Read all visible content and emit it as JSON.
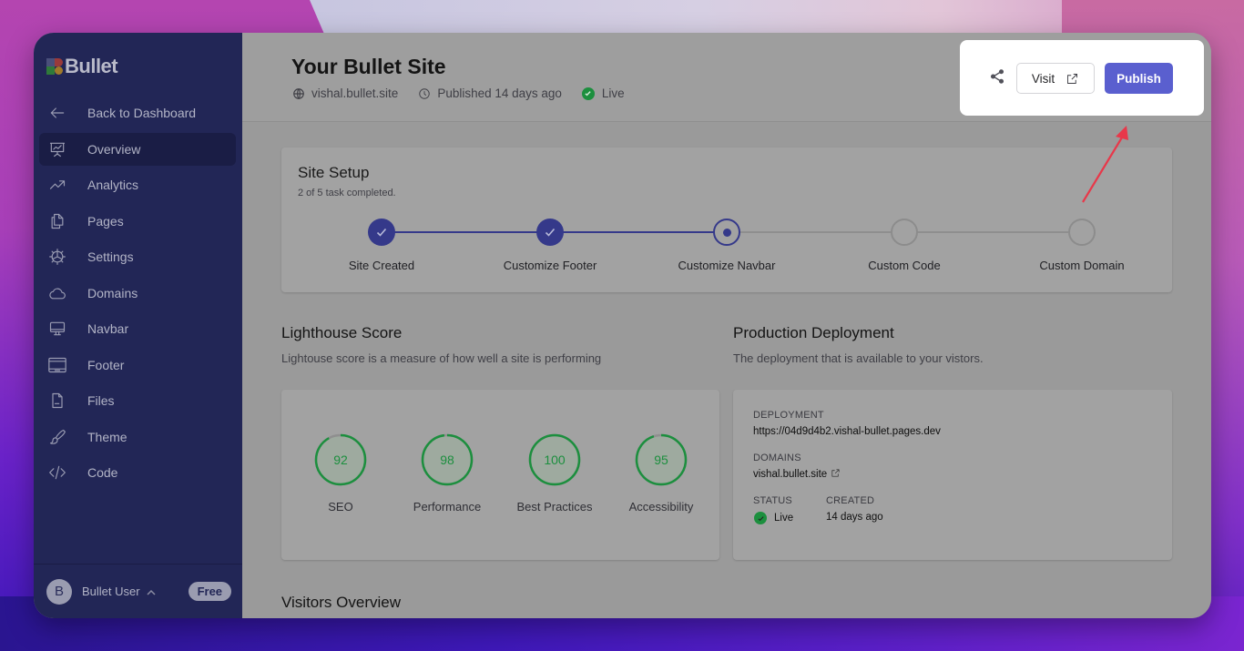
{
  "app": {
    "logo_text": "Bullet"
  },
  "sidebar": {
    "back_label": "Back to Dashboard",
    "items": [
      {
        "label": "Overview",
        "icon": "presentation-chart-icon",
        "active": true
      },
      {
        "label": "Analytics",
        "icon": "trending-up-icon"
      },
      {
        "label": "Pages",
        "icon": "pages-icon"
      },
      {
        "label": "Settings",
        "icon": "gear-icon"
      },
      {
        "label": "Domains",
        "icon": "cloud-icon"
      },
      {
        "label": "Navbar",
        "icon": "monitor-icon"
      },
      {
        "label": "Footer",
        "icon": "layout-footer-icon"
      },
      {
        "label": "Files",
        "icon": "file-icon"
      },
      {
        "label": "Theme",
        "icon": "brush-icon"
      },
      {
        "label": "Code",
        "icon": "code-icon"
      }
    ],
    "user": {
      "initial": "B",
      "name": "Bullet User",
      "plan": "Free"
    }
  },
  "header": {
    "title": "Your Bullet Site",
    "domain": "vishal.bullet.site",
    "published": "Published 14 days ago",
    "status": "Live",
    "visit_label": "Visit",
    "publish_label": "Publish"
  },
  "setup": {
    "title": "Site Setup",
    "subtitle": "2 of 5 task completed.",
    "completed": 2,
    "total": 5,
    "steps": [
      {
        "label": "Site Created",
        "state": "done"
      },
      {
        "label": "Customize Footer",
        "state": "done"
      },
      {
        "label": "Customize Navbar",
        "state": "current"
      },
      {
        "label": "Custom Code",
        "state": "todo"
      },
      {
        "label": "Custom Domain",
        "state": "todo"
      }
    ]
  },
  "lighthouse": {
    "title": "Lighthouse Score",
    "subtitle": "Lightouse score is a measure of how well a site is performing",
    "scores": [
      {
        "label": "SEO",
        "value": 92
      },
      {
        "label": "Performance",
        "value": 98
      },
      {
        "label": "Best Practices",
        "value": 100
      },
      {
        "label": "Accessibility",
        "value": 95
      }
    ]
  },
  "deployment": {
    "title": "Production Deployment",
    "subtitle": "The deployment that is available to your vistors.",
    "deployment_label": "Deployment",
    "deployment_url": "https://04d9d4b2.vishal-bullet.pages.dev",
    "domains_label": "Domains",
    "domain": "vishal.bullet.site",
    "status_label": "Status",
    "status": "Live",
    "created_label": "Created",
    "created": "14 days ago"
  },
  "visitors": {
    "title": "Visitors Overview"
  },
  "colors": {
    "sidebar_bg": "#222656",
    "primary": "#5a5fcf",
    "step_done": "#35398a",
    "score_green": "#1c8f3e",
    "live_green": "#1c8f3e",
    "arrow_red": "#e8384a"
  }
}
